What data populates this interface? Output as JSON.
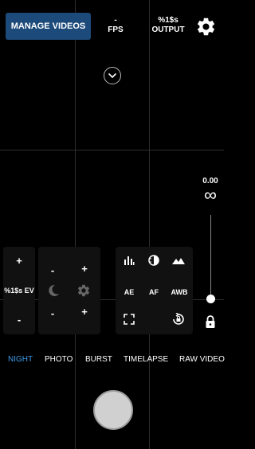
{
  "top_bar": {
    "manage_videos_label": "MANAGE VIDEOS",
    "fps_value": "-",
    "fps_label": "FPS",
    "output_value": "%1$s",
    "output_label": "OUTPUT"
  },
  "exposure": {
    "ev_value": "0.00",
    "focus_label": "∞"
  },
  "left_panel": {
    "plus_label": "+",
    "ev_label": "%1$s EV",
    "minus_label": "-"
  },
  "mid_panel": {
    "top_minus": "-",
    "top_plus": "+",
    "bottom_minus": "-",
    "bottom_plus": "+"
  },
  "right_panel": {
    "ae_label": "AE",
    "af_label": "AF",
    "awb_label": "AWB"
  },
  "modes": [
    {
      "label": "NIGHT",
      "active": true
    },
    {
      "label": "PHOTO",
      "active": false
    },
    {
      "label": "BURST",
      "active": false
    },
    {
      "label": "TIMELAPSE",
      "active": false
    },
    {
      "label": "RAW VIDEO",
      "active": false
    }
  ],
  "colors": {
    "accent": "#3d9be9",
    "button_bg": "#1c4a7a"
  }
}
